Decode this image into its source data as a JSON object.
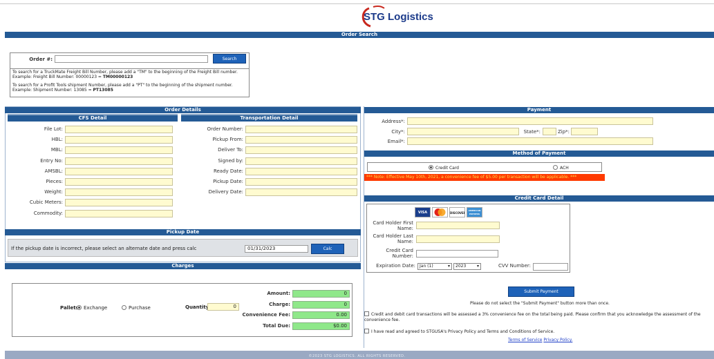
{
  "logo": {
    "text": "STG Logistics"
  },
  "order_search": {
    "title": "Order Search",
    "label": "Order #:",
    "value": "",
    "button": "Search",
    "help": [
      "To search for a TruckMate Freight Bill Number, please add a \"TM\" to the beginning of the Freight Bill number.",
      "Example: Freight Bill Number: 00000123 = ",
      "TM00000123",
      "To search for a Profit Tools shipment Number, please add a \"PT\" to the beginning of the shipment number.",
      "Example: Shipment Number: 13085 = ",
      "PT13085"
    ]
  },
  "order_details": {
    "title": "Order Details",
    "cfs": {
      "title": "CFS Detail",
      "fields": [
        "File Lot:",
        "HBL:",
        "MBL:",
        "Entry No:",
        "AMSBL:",
        "Pieces:",
        "Weight:",
        "Cubic Meters:",
        "Commodity:"
      ]
    },
    "transport": {
      "title": "Transportation Detail",
      "fields": [
        "Order Number:",
        "Pickup From:",
        "Deliver To:",
        "Signed by:",
        "Ready Date:",
        "Pickup Date:",
        "Delivery Date:"
      ]
    }
  },
  "pickup_date": {
    "title": "Pickup Date",
    "text": "If the pickup date is incorrect, please select an alternate date and press calc",
    "value": "01/31/2023",
    "button": "Calc"
  },
  "charges": {
    "title": "Charges",
    "pallets_label": "Pallets",
    "exchange": "Exchange",
    "purchase": "Purchase",
    "quantity_label": "Quantity",
    "quantity": "0",
    "rows": [
      {
        "label": "Amount:",
        "value": "0"
      },
      {
        "label": "Charge:",
        "value": "0"
      },
      {
        "label": "Convenience Fee:",
        "value": "0.00"
      },
      {
        "label": "Total Due:",
        "value": "$0.00"
      }
    ]
  },
  "payment": {
    "title": "Payment",
    "address_label": "Address*:",
    "city_label": "City*:",
    "state_label": "State*:",
    "zip_label": "Zip*:",
    "email_label": "Email*:"
  },
  "method": {
    "title": "Method of Payment",
    "credit": "Credit Card",
    "ach": "ACH",
    "note": "*** Note: Effective May 10th, 2021, a convenience fee of $5.00 per transaction will be applicable. ***"
  },
  "card": {
    "title": "Credit Card Detail",
    "brands": [
      "VISA",
      "MasterCard",
      "DISCOVER",
      "AMERICAN EXPRESS"
    ],
    "first_name_label": [
      "Card Holder First",
      "Name:"
    ],
    "last_name_label": [
      "Card Holder Last",
      "Name:"
    ],
    "number_label": [
      "Credit Card",
      "Number:"
    ],
    "expiration_label": "Expiration Date:",
    "month": "Jan (1)",
    "year": "2023",
    "cvv_label": "CVV Number:",
    "submit": "Submit Payment",
    "warning": "Please do not select the \"Submit Payment\" button more than once.",
    "fee_ack": "Credit and debit card transactions will be assessed a 3% convenience fee on the total being paid. Please confirm that you acknowledge the assessment of the convenience fee.",
    "agree": "I have read and agreed to STGUSA's Privacy Policy and Terms and Conditions of Service.",
    "terms_link": "Terms of Service",
    "privacy_link": "Privacy Policy."
  },
  "footer": {
    "text": "©2023 STG LOGISTICS. ALL RIGHTS RESERVED."
  },
  "colors": {
    "header_blue": "#245a95",
    "input_yellow": "#fffbd0",
    "total_green": "#8fe88a",
    "note_red": "#ff3a00"
  }
}
